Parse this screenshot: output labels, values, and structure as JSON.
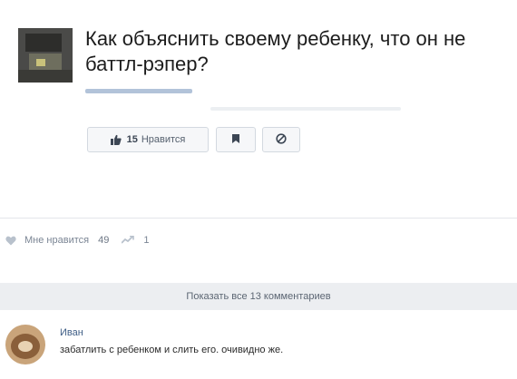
{
  "post": {
    "title": "Как объяснить своему ребенку, что он не баттл-рэпер?",
    "actions": {
      "like_count": "15",
      "like_label": "Нравится"
    }
  },
  "stats": {
    "likes_label": "Мне нравится",
    "likes_count": "49",
    "shares_count": "1"
  },
  "comments": {
    "show_all_label": "Показать все 13 комментариев",
    "items": [
      {
        "author": "Иван",
        "text": "забатлить с ребенком и слить его. очивидно же."
      }
    ]
  },
  "colors": {
    "link_blue": "#3f5e86",
    "muted_gray": "#7a8594",
    "panel_bg": "#eceef1"
  },
  "icons": {
    "like": "thumbs-up-icon",
    "bookmark": "bookmark-icon",
    "block": "block-icon",
    "heart": "heart-icon",
    "share": "share-icon"
  }
}
